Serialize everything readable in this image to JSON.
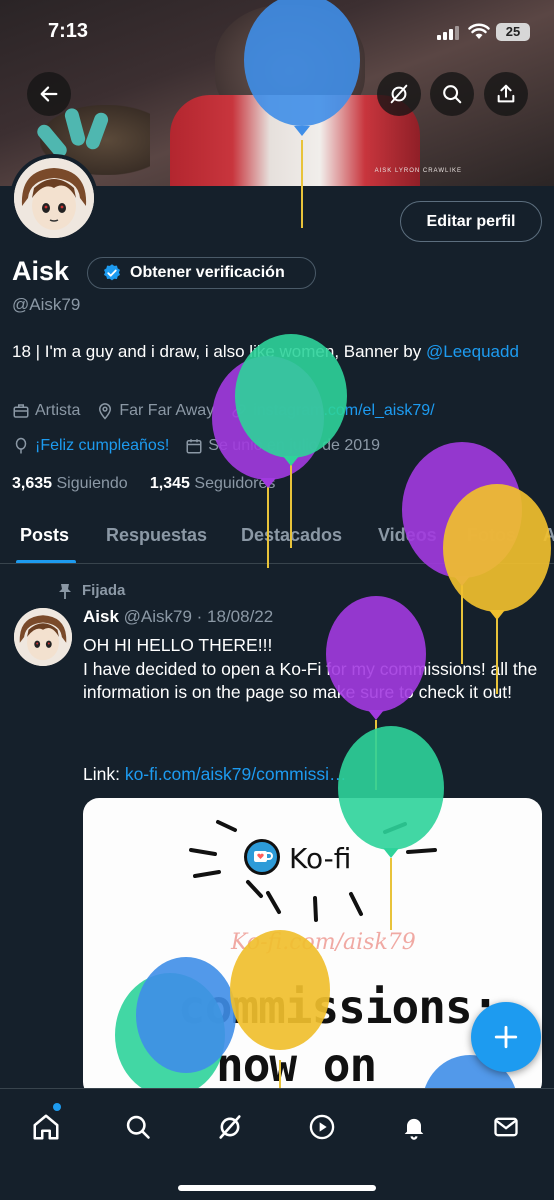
{
  "status_bar": {
    "time": "7:13",
    "battery": "25"
  },
  "banner": {
    "caption": "AISK LYRON CRAWLIKE"
  },
  "profile": {
    "edit_button": "Editar perfil",
    "name": "Aisk",
    "verify_label": "Obtener verificación",
    "handle": "@Aisk79",
    "bio_text": "18 | I'm a guy and i draw, i also like women, Banner by ",
    "bio_mention": "@Leequadd",
    "category": "Artista",
    "location": "Far Far Away",
    "website": "instagram.com/el_aisk79/",
    "birthday": "¡Feliz cumpleaños!",
    "joined": "Se unió en julio de 2019",
    "following_count": "3,635",
    "following_label": "Siguiendo",
    "followers_count": "1,345",
    "followers_label": "Seguidores"
  },
  "tabs": [
    "Posts",
    "Respuestas",
    "Destacados",
    "Videos",
    "Fotos",
    "A"
  ],
  "post": {
    "pinned_label": "Fijada",
    "author": "Aisk",
    "handle_date": "@Aisk79 · 18/08/22",
    "line1": "OH HI HELLO THERE!!!",
    "body": "I have decided to open a Ko-Fi for my commissions! all the information is on the page so make sure to check it out!",
    "link_prefix": "Link: ",
    "link": "ko-fi.com/aisk79/commissi…",
    "image": {
      "logo_text": "Ko-fi",
      "url_text": "Ko-fi.com/aisk79",
      "line1": "commissions:",
      "line2": "now on"
    }
  },
  "colors": {
    "accent": "#1d9bf0",
    "background": "#15202b",
    "muted": "#8b98a5"
  },
  "icons": {
    "back": "arrow-left-icon",
    "grok": "grok-icon",
    "search": "search-icon",
    "share": "share-icon",
    "verified": "verified-badge-icon",
    "briefcase": "briefcase-icon",
    "location": "location-pin-icon",
    "link": "link-icon",
    "balloon": "balloon-icon",
    "calendar": "calendar-icon",
    "pin": "pin-icon",
    "compose": "plus-icon",
    "home": "home-icon",
    "nav_search": "search-icon",
    "nav_grok": "grok-icon",
    "play": "play-circle-icon",
    "bell": "bell-icon",
    "mail": "mail-icon"
  }
}
